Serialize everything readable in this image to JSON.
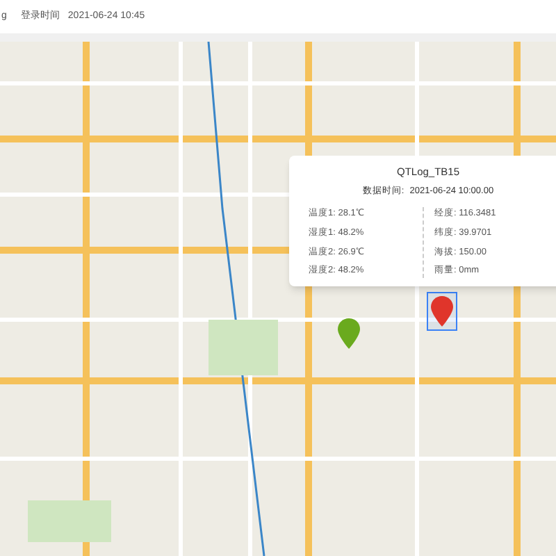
{
  "header": {
    "user_fragment": "g",
    "login_label": "登录时间",
    "login_time": "2021-06-24 10:45"
  },
  "popup": {
    "title": "QTLog_TB15",
    "time_label": "数据时间:",
    "time": "2021-06-24 10:00.00",
    "left": [
      "温度1: 28.1℃",
      "湿度1: 48.2%",
      "温度2: 26.9℃",
      "湿度2: 48.2%"
    ],
    "right": [
      "经度: 116.3481",
      "纬度: 39.9701",
      "海拔: 150.00",
      "雨量: 0mm"
    ]
  },
  "markers": [
    {
      "color": "#6aaa1e",
      "selected": false
    },
    {
      "color": "#e0352b",
      "selected": true
    }
  ]
}
